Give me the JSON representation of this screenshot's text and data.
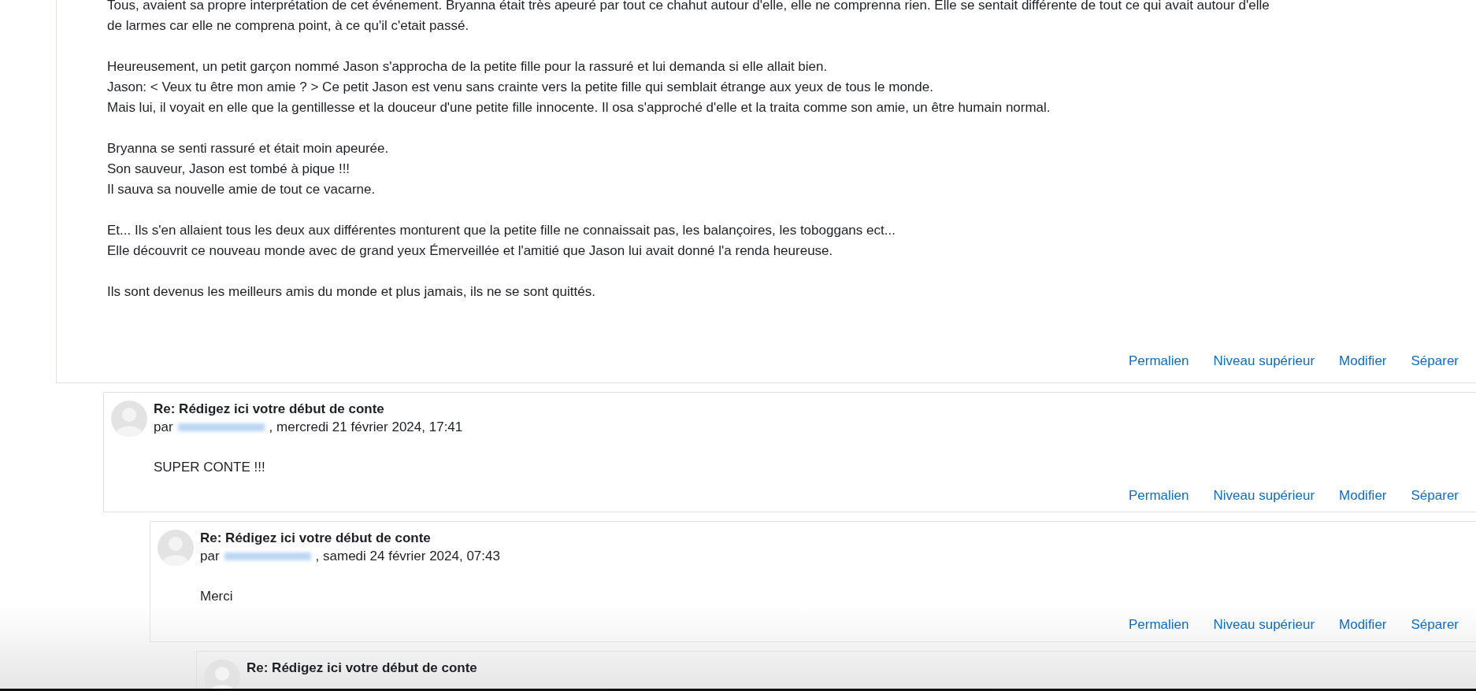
{
  "post": {
    "paragraphs": [
      [
        "Tous, avaient sa propre interprétation de cet événement. Bryanna était très apeuré par tout ce chahut autour d'elle, elle ne comprenna rien. Elle se sentait différente de tout ce qui avait autour d'elle",
        "de larmes car elle ne comprena point, à ce qu'il c'etait passé."
      ],
      [
        "Heureusement, un petit garçon nommé Jason s'approcha de la petite fille pour la rassuré et lui demanda si elle allait bien.",
        "Jason: < Veux tu être mon amie ? > Ce petit Jason est venu sans crainte vers la petite fille qui semblait étrange aux yeux de tous le monde.",
        "Mais lui, il voyait en elle que la gentillesse et la douceur d'une petite fille innocente. Il osa s'approché d'elle et la traita comme son amie, un être humain normal."
      ],
      [
        "Bryanna se senti rassuré et était moin apeurée.",
        "Son sauveur, Jason est tombé à pique !!!",
        "Il sauva sa nouvelle amie de tout ce vacarne."
      ],
      [
        "Et... Ils s'en allaient tous les deux aux différentes monturent que la petite fille ne connaissait pas, les balançoires, les toboggans ect...",
        "Elle découvrit ce nouveau monde avec de grand yeux Émerveillée et l'amitié que Jason lui avait donné l'a renda heureuse."
      ],
      [
        "Ils sont devenus les meilleurs amis du monde et plus jamais, ils ne se sont quittés."
      ]
    ],
    "actions": [
      "Permalien",
      "Niveau supérieur",
      "Modifier",
      "Séparer"
    ],
    "children": [
      {
        "title": "Re: Rédigez ici votre début de conte",
        "by": "par",
        "date": ", mercredi 21 février 2024, 17:41",
        "body": "SUPER CONTE !!!",
        "actions": [
          "Permalien",
          "Niveau supérieur",
          "Modifier",
          "Séparer"
        ],
        "children": [
          {
            "title": "Re: Rédigez ici votre début de conte",
            "by": "par",
            "date": ", samedi 24 février 2024, 07:43",
            "body": "Merci",
            "actions": [
              "Permalien",
              "Niveau supérieur",
              "Modifier",
              "Séparer"
            ],
            "children": [
              {
                "title": "Re: Rédigez ici votre début de conte"
              }
            ]
          }
        ]
      }
    ]
  }
}
